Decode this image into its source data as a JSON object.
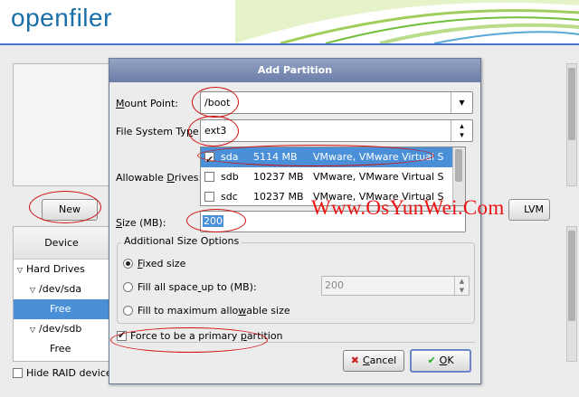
{
  "app": {
    "logo_text": "openfiler"
  },
  "background": {
    "new_button": "New",
    "lvm_button": "LVM",
    "tree_header": "Device",
    "tree": [
      {
        "label": "Hard Drives",
        "expand": "▽",
        "indent": 0,
        "selected": false
      },
      {
        "label": "/dev/sda",
        "expand": "▽",
        "indent": 1,
        "selected": false
      },
      {
        "label": "Free",
        "expand": "",
        "indent": 2,
        "selected": true
      },
      {
        "label": "/dev/sdb",
        "expand": "▽",
        "indent": 1,
        "selected": false
      },
      {
        "label": "Free",
        "expand": "",
        "indent": 2,
        "selected": false
      }
    ],
    "hide_raid_label": "Hide RAID device/"
  },
  "dialog": {
    "title": "Add Partition",
    "mount_point_label": "Mount Point:",
    "mount_point_value": "/boot",
    "fs_type_label": "File System Type:",
    "fs_type_value": "ext3",
    "drives_label": "Allowable Drives:",
    "drives": [
      {
        "checked": true,
        "name": "sda",
        "size": "5114 MB",
        "model": "VMware, VMware Virtual S",
        "selected": true
      },
      {
        "checked": false,
        "name": "sdb",
        "size": "10237 MB",
        "model": "VMware, VMware Virtual S",
        "selected": false
      },
      {
        "checked": false,
        "name": "sdc",
        "size": "10237 MB",
        "model": "VMware, VMware Virtual S",
        "selected": false
      }
    ],
    "size_label": "Size (MB):",
    "size_value": "200",
    "additional_options_title": "Additional Size Options",
    "opt_fixed": "Fixed size",
    "opt_fill_upto": "Fill all space up to (MB):",
    "fill_upto_value": "200",
    "opt_fill_max": "Fill to maximum allowable size",
    "primary_label": "Force to be a primary partition",
    "primary_checked": true,
    "cancel_button": "Cancel",
    "ok_button": "OK"
  },
  "watermark": "Www.OsYunWei.Com",
  "colors": {
    "selection": "#4a90d9",
    "annotation": "#d01010",
    "brand": "#1a6fa8",
    "title_bar": "#7a8cb4"
  }
}
